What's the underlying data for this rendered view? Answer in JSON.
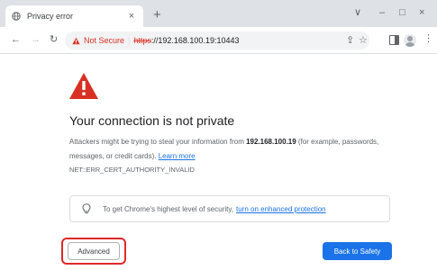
{
  "tab": {
    "title": "Privacy error",
    "close_glyph": "×",
    "new_tab_glyph": "+"
  },
  "window_controls": {
    "tab_search": "∨",
    "minimize": "–",
    "maximize": "□",
    "close": "×"
  },
  "toolbar": {
    "back": "←",
    "forward": "→",
    "reload": "↻",
    "security_label": "Not Secure",
    "separator": "|",
    "url_scheme": "https",
    "url_rest": "://192.168.100.19:10443",
    "share_glyph": "⇪",
    "bookmark_glyph": "☆",
    "menu_glyph": "⋮"
  },
  "interstitial": {
    "heading": "Your connection is not private",
    "desc_part1": "Attackers might be trying to steal your information from ",
    "desc_host": "192.168.100.19",
    "desc_part2": " (for example, passwords, messages, or credit cards). ",
    "learn_more": "Learn more",
    "error_code": "NET::ERR_CERT_AUTHORITY_INVALID",
    "promo_text": "To get Chrome's highest level of security,",
    "promo_link": "turn on enhanced protection",
    "advanced_button": "Advanced",
    "back_button": "Back to Safety"
  },
  "colors": {
    "danger": "#d93025",
    "link": "#1a73e8",
    "primary_button": "#1a73e8",
    "highlight": "#e02828"
  },
  "icons": [
    "globe-icon",
    "warning-icon",
    "shield-warning-icon",
    "lightbulb-icon",
    "share-icon",
    "bookmark-star-icon",
    "side-panel-icon",
    "avatar",
    "menu-icon"
  ]
}
